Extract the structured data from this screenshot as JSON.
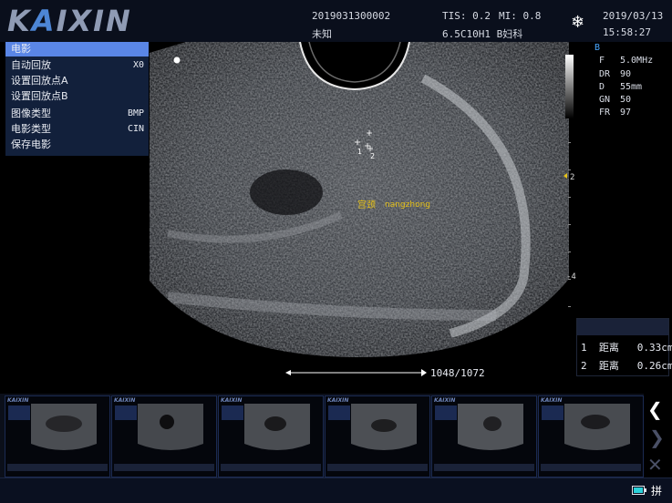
{
  "header": {
    "logo_a": "K",
    "logo_b": "A",
    "logo_c": "IXIN",
    "patient_id": "2019031300002",
    "patient_name": "未知",
    "tis": "TIS: 0.2",
    "mi": "MI: 0.8",
    "probe_exam": "6.5C10H1 B妇科",
    "date": "2019/03/13",
    "time": "15:58:27",
    "freeze_icon": "snowflake-icon"
  },
  "menu": {
    "title": "电影",
    "items": [
      {
        "label": "自动回放",
        "value": "X0"
      },
      {
        "label": "设置回放点A",
        "value": ""
      },
      {
        "label": "设置回放点B",
        "value": ""
      },
      {
        "label": "图像类型",
        "value": "BMP"
      },
      {
        "label": "电影类型",
        "value": "CIN"
      },
      {
        "label": "保存电影",
        "value": ""
      }
    ]
  },
  "params": {
    "mode": "B",
    "rows": [
      {
        "k": "F",
        "v": "5.0MHz"
      },
      {
        "k": "DR",
        "v": "90"
      },
      {
        "k": "D",
        "v": "55mm"
      },
      {
        "k": "GN",
        "v": "50"
      },
      {
        "k": "FR",
        "v": "97"
      }
    ]
  },
  "image": {
    "annotation_cn": "宫颈",
    "annotation_en": "nangzhong",
    "caliper_1": "1",
    "caliper_2": "2",
    "depth_mark_2": "2",
    "depth_mark_4": "4",
    "cine_counter": "1048/1072"
  },
  "measurements": [
    {
      "index": "1",
      "label": "距离",
      "value": "0.33cm"
    },
    {
      "index": "2",
      "label": "距离",
      "value": "0.26cm"
    }
  ],
  "thumbnails": {
    "count": 6,
    "logo": "KAIXIN"
  },
  "nav": {
    "prev_icon": "chevron-left-icon",
    "next_icon": "chevron-right-icon",
    "close_icon": "close-icon"
  },
  "bottom": {
    "battery_icon": "battery-icon",
    "mode_label": "拼"
  },
  "colors": {
    "menu_bg": "#12203b",
    "menu_selected": "#5a86e6",
    "annotation": "#e6c21a",
    "logo": "#8f9bb4"
  }
}
